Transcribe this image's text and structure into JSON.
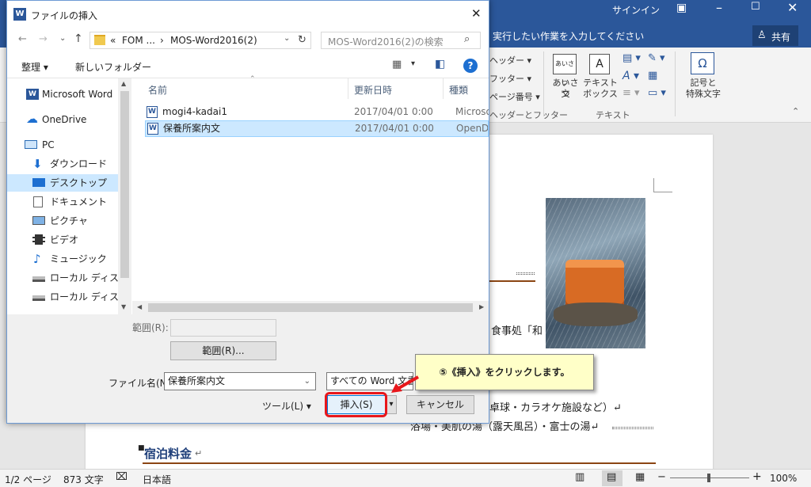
{
  "word": {
    "signin": "サインイン",
    "tell_me": "実行したい作業を入力してください",
    "share": "共有",
    "ribbon": {
      "header": "ヘッダー",
      "footer": "フッター",
      "page_number": "ページ番号",
      "group_header_footer": "ヘッダーとフッター",
      "greeting_line1": "あいさつ",
      "greeting_line2": "文",
      "textbox_line1": "テキスト",
      "textbox_line2": "ボックス",
      "group_text": "テキスト",
      "symbols_line1": "記号と",
      "symbols_line2": "特殊文字",
      "greeting_icon_text": "あいさつ"
    },
    "doc": {
      "text_fragment1": "食事処「和",
      "text_fragment2": "卓球・カラオケ施設など）↵",
      "text_fragment3": "浴場・美肌の湯（露天風呂）・富士の湯↵",
      "heading": "宿泊料金",
      "heading_mark": "↵"
    },
    "status": {
      "page": "1/2 ページ",
      "words": "873 文字",
      "language": "日本語",
      "zoom": "100%"
    }
  },
  "dialog": {
    "title": "ファイルの挿入",
    "breadcrumb": {
      "prefix": "«",
      "item1": "FOM ...",
      "sep": "›",
      "item2": "MOS-Word2016(2)"
    },
    "search_placeholder": "MOS-Word2016(2)の検索",
    "organize": "整理 ▾",
    "new_folder": "新しいフォルダー",
    "nav": [
      {
        "label": "Microsoft Word",
        "icon": "word-icon"
      },
      {
        "label": "OneDrive",
        "icon": "cloud-icon"
      },
      {
        "label": "PC",
        "icon": "computer-icon"
      },
      {
        "label": "ダウンロード",
        "icon": "download-icon"
      },
      {
        "label": "デスクトップ",
        "icon": "desktop-icon"
      },
      {
        "label": "ドキュメント",
        "icon": "document-icon"
      },
      {
        "label": "ピクチャ",
        "icon": "picture-icon"
      },
      {
        "label": "ビデオ",
        "icon": "video-icon"
      },
      {
        "label": "ミュージック",
        "icon": "music-icon"
      },
      {
        "label": "ローカル ディスク (C",
        "icon": "drive-icon"
      },
      {
        "label": "ローカル ディスク (D",
        "icon": "drive-icon"
      }
    ],
    "columns": {
      "name": "名前",
      "date": "更新日時",
      "type": "種類"
    },
    "files": [
      {
        "name": "mogi4-kadai1",
        "date": "2017/04/01 0:00",
        "type": "Microsoft"
      },
      {
        "name": "保養所案内文",
        "date": "2017/04/01 0:00",
        "type": "OpenDoc"
      }
    ],
    "range_label": "範囲(R):",
    "range_button": "範囲(R)...",
    "filename_label": "ファイル名(N):",
    "filename_value": "保養所案内文",
    "filetype_value": "すべての Word 文書",
    "tools": "ツール(L)",
    "insert": "挿入(S)",
    "cancel": "キャンセル"
  },
  "callout": {
    "text": "⑤《挿入》をクリックします。"
  },
  "colors": {
    "word_blue": "#2b579a",
    "callout_bg": "#ffffc8",
    "highlight_red": "#e8171b",
    "selection": "#cce8ff"
  }
}
